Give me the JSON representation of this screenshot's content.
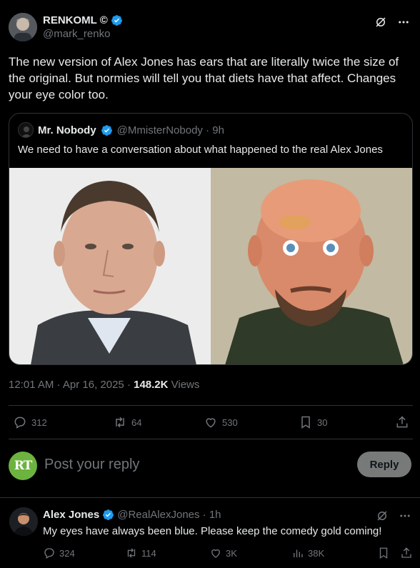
{
  "main_tweet": {
    "display_name": "RENKOML ©",
    "handle": "@mark_renko",
    "text": "The new version of Alex Jones has ears that are literally twice the size of the original.  But normies will tell you that diets have that affect.  Changes your eye color too.",
    "timestamp": "12:01 AM · Apr 16, 2025 · ",
    "views_count": "148.2K",
    "views_label": " Views"
  },
  "quote": {
    "display_name": "Mr. Nobody",
    "handle": "@MmisterNobody · 9h",
    "text": "We need to have a conversation about what happened to the real Alex Jones"
  },
  "stats": {
    "replies": "312",
    "reposts": "64",
    "likes": "530",
    "bookmarks": "30"
  },
  "composer": {
    "avatar_text": "RT",
    "placeholder": "Post your reply",
    "reply_label": "Reply"
  },
  "reply": {
    "display_name": "Alex Jones",
    "handle": "@RealAlexJones · 1h",
    "text": "My eyes have always been blue. Please keep the comedy gold coming!",
    "replies": "324",
    "reposts": "114",
    "likes": "3K",
    "views": "38K"
  },
  "colors": {
    "background": "#000000",
    "text": "#e7e9ea",
    "muted": "#71767b",
    "verified": "#1d9bf0",
    "border": "#2f3336",
    "reply_button": "#787a7a",
    "rt_green": "#6cb33f"
  }
}
